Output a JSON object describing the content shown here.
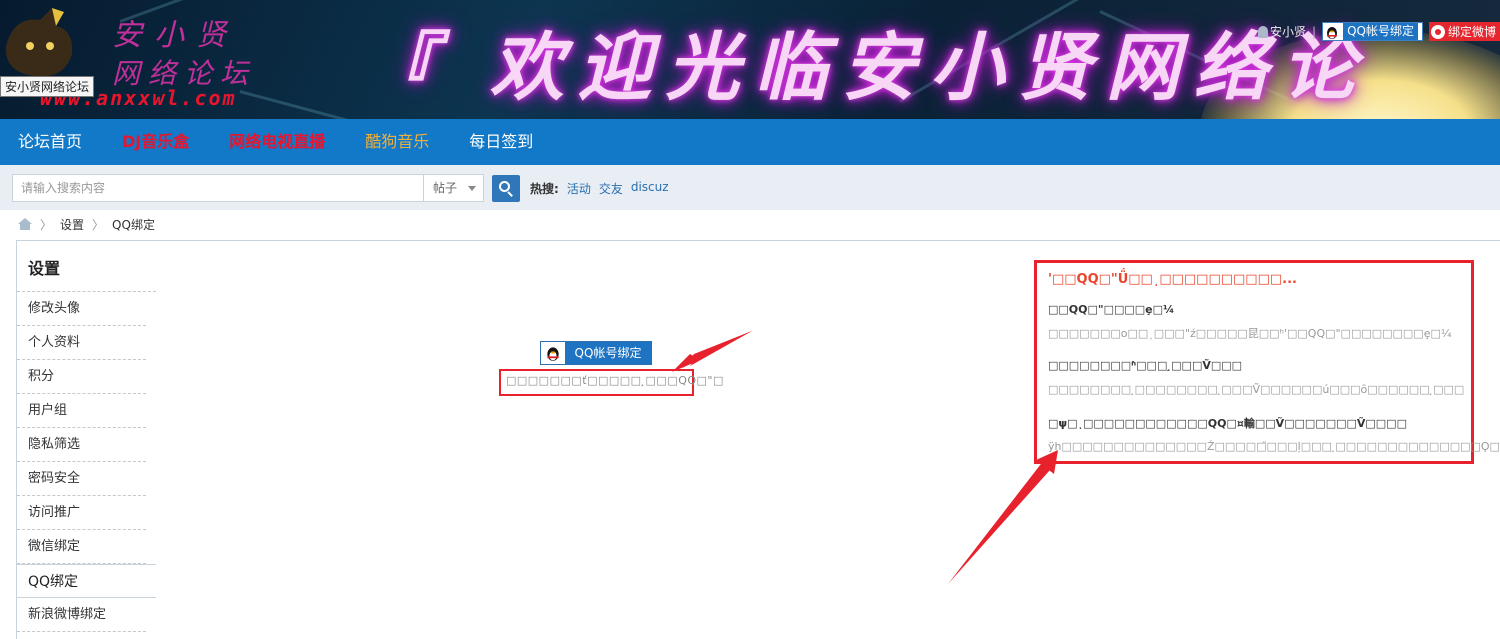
{
  "banner": {
    "logo_line1": "安小贤",
    "logo_line2": "网络论坛",
    "logo_url": "www.anxxwl.com",
    "tooltip": "安小贤网络论坛",
    "welcome_text": "『 欢迎光临安小贤网络论",
    "user_link": "安小贤",
    "qq_bind_label": "QQ帐号绑定",
    "weibo_bind_label": "绑定微博"
  },
  "nav": {
    "items": [
      {
        "label": "论坛首页"
      },
      {
        "label": "DJ音乐盒"
      },
      {
        "label": "网络电视直播"
      },
      {
        "label": "酷狗音乐"
      },
      {
        "label": "每日签到"
      }
    ]
  },
  "search": {
    "placeholder": "请输入搜索内容",
    "type_selected": "帖子",
    "hot_label": "热搜:",
    "hot_links": [
      "活动",
      "交友",
      "discuz"
    ]
  },
  "breadcrumb": {
    "items": [
      "设置",
      "QQ绑定"
    ]
  },
  "sidebar": {
    "title": "设置",
    "items": [
      {
        "label": "修改头像"
      },
      {
        "label": "个人资料"
      },
      {
        "label": "积分"
      },
      {
        "label": "用户组"
      },
      {
        "label": "隐私筛选"
      },
      {
        "label": "密码安全"
      },
      {
        "label": "访问推广"
      },
      {
        "label": "微信绑定"
      },
      {
        "label": "QQ绑定"
      },
      {
        "label": "新浪微博绑定"
      }
    ]
  },
  "main": {
    "qq_bind_button": "QQ帐号绑定",
    "qq_hint": "□□□□□□□ť□□□□□ ̧□□□QQ□\"□"
  },
  "info": {
    "title": "'□□QQ□\"Ǘ□□ͺ□□□□□□□□□□...",
    "h1": "□□QQ□\"□□□□ȩ□¼",
    "p1": "□□□□□□□o□□ͺ□□□\"ź□□□□□昆□□ʰ'□□QQ□\"□□□□□□□□ȩ□¼",
    "h2": "□□□□□□□□ʱ□□□ ̧□□□Ṽ□□□",
    "p2": "□□□□□□□□ ̧□□□□□□□□ ̧□□□Ṽ□□□□□□ú□□□ȏ□□□□□□ ̧□□□",
    "h3": "□ψ□ͺ□□□□□□□□□□□□QQ□¤輸□□Ṽ□□□□□□□Ṽ□□□□",
    "p3": "ÿh□□□□□□□□□□□□□□Ź□□□□□̋□□□ļ□□□ ̧□□□□□□□□□□□□□□Ϙ□□□□□"
  }
}
